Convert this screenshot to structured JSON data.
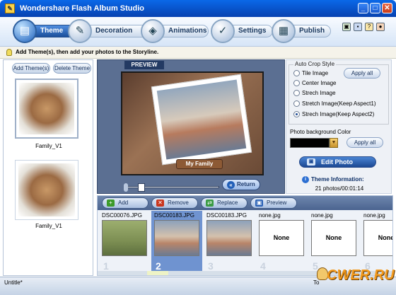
{
  "window": {
    "title": "Wondershare Flash Album Studio",
    "controls": [
      "_",
      "□",
      "✕"
    ]
  },
  "toolbar": {
    "tabs": [
      {
        "label": "Theme",
        "active": true,
        "icon": "theme-icon",
        "glyph": "▤"
      },
      {
        "label": "Decoration",
        "active": false,
        "icon": "palette-icon",
        "glyph": "✎"
      },
      {
        "label": "Animations",
        "active": false,
        "icon": "film-icon",
        "glyph": "◈"
      },
      {
        "label": "Settings",
        "active": false,
        "icon": "settings-icon",
        "glyph": "✓"
      },
      {
        "label": "Publish",
        "active": false,
        "icon": "publish-icon",
        "glyph": "▦"
      }
    ],
    "quick_icons": [
      "new-icon",
      "save-icon",
      "help-icon",
      "user-icon"
    ],
    "quick_glyphs": [
      "▣",
      "▪",
      "?",
      "●"
    ]
  },
  "hint": {
    "text": "Add Theme(s), then add your photos to the Storyline."
  },
  "theme_panel": {
    "add_label": "Add Theme(s)",
    "delete_label": "Delete Theme",
    "themes": [
      {
        "name": "Family_V1",
        "selected": true
      },
      {
        "name": "Family_V1",
        "selected": false
      }
    ]
  },
  "preview": {
    "label": "PREVIEW",
    "badge": "My Family",
    "return_label": "Return"
  },
  "crop": {
    "legend": "Auto Crop Style",
    "options": [
      {
        "label": "Tile Image",
        "selected": false
      },
      {
        "label": "Center Image",
        "selected": false
      },
      {
        "label": "Strech Image",
        "selected": false
      },
      {
        "label": "Stretch Image(Keep Aspect1)",
        "selected": false
      },
      {
        "label": "Strech Image(Keep Aspect2)",
        "selected": true
      }
    ],
    "apply_all_label": "Apply all"
  },
  "bg": {
    "label": "Photo background Color",
    "color": "#000000",
    "apply_all_label": "Apply all"
  },
  "edit": {
    "label": "Edit Photo"
  },
  "info": {
    "title": "Theme Information:",
    "value": "21 photos/00:01:14"
  },
  "storyline": {
    "buttons": [
      {
        "label": "Add",
        "icon": "add-icon",
        "glyph": "+",
        "color": "#3c9a2a"
      },
      {
        "label": "Remove",
        "icon": "remove-icon",
        "glyph": "✕",
        "color": "#c9361e"
      },
      {
        "label": "Replace",
        "icon": "replace-icon",
        "glyph": "⇄",
        "color": "#3b9b45"
      },
      {
        "label": "Preview",
        "icon": "preview-icon",
        "glyph": "▣",
        "color": "#2b62b6"
      }
    ],
    "slots": [
      {
        "name": "DSC00076.JPG",
        "num": "1",
        "kind": "goat",
        "selected": false,
        "none_text": ""
      },
      {
        "name": "DSC00183.JPG",
        "num": "2",
        "kind": "family",
        "selected": true,
        "none_text": ""
      },
      {
        "name": "DSC00183.JPG",
        "num": "3",
        "kind": "family",
        "selected": false,
        "none_text": ""
      },
      {
        "name": "none.jpg",
        "num": "4",
        "kind": "none",
        "selected": false,
        "none_text": "None"
      },
      {
        "name": "none.jpg",
        "num": "5",
        "kind": "none",
        "selected": false,
        "none_text": "None"
      },
      {
        "name": "none.jpg",
        "num": "6",
        "kind": "none",
        "selected": false,
        "none_text": "None"
      }
    ]
  },
  "status": {
    "left": "Untitle*",
    "right": "To"
  },
  "watermark": {
    "text": "CWER.RU"
  }
}
